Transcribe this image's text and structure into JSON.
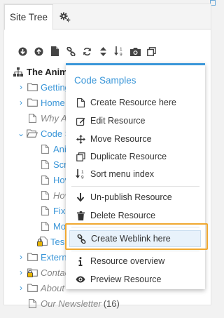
{
  "tabs": {
    "site_tree": "Site Tree",
    "settings_icon": "gear-icon"
  },
  "toolbar": [
    "down-circle-icon",
    "up-circle-icon",
    "document-icon",
    "link-icon",
    "refresh-icon",
    "sort-updown-icon",
    "sort-numeric-icon",
    "camera-icon",
    "copy-icon"
  ],
  "tree": {
    "root": "The Anim",
    "items": {
      "getting": "Getting",
      "home": "Home",
      "why": "Why An",
      "code": "Code S",
      "ani": "Ani",
      "scr": "Scr",
      "hov1": "Hov",
      "hov2": "Hov",
      "fix": "Fixe",
      "mob": "Mob",
      "tes": "Tes",
      "extern": "Extern",
      "contact": "Contac",
      "about": "About",
      "news": "Our Newsletter",
      "news_count": "(16)"
    }
  },
  "menu": {
    "title": "Code Samples",
    "items": {
      "create": "Create Resource here",
      "edit": "Edit Resource",
      "move": "Move Resource",
      "duplicate": "Duplicate Resource",
      "sort": "Sort menu index",
      "unpublish": "Un-publish Resource",
      "delete": "Delete Resource",
      "weblink": "Create Weblink here",
      "overview": "Resource overview",
      "preview": "Preview Resource"
    }
  },
  "colors": {
    "accent": "#3a96d8",
    "focus": "#f0a830"
  }
}
